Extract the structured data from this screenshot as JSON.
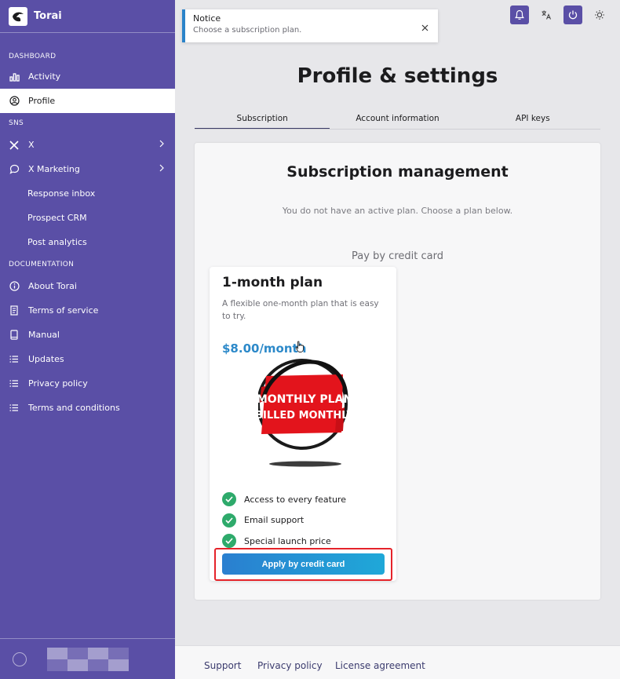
{
  "app": {
    "name": "Torai"
  },
  "sidebar": {
    "sections": [
      {
        "label": "DASHBOARD"
      },
      {
        "label": "SNS"
      },
      {
        "label": "DOCUMENTATION"
      }
    ],
    "items": [
      {
        "label": "Activity",
        "icon": "bar-chart-icon"
      },
      {
        "label": "Profile",
        "icon": "user-circle-icon",
        "active": true
      },
      {
        "label": "X",
        "icon": "x-logo-icon"
      },
      {
        "label": "X Marketing",
        "icon": "chat-bubble-icon"
      },
      {
        "label": "Response inbox"
      },
      {
        "label": "Prospect CRM"
      },
      {
        "label": "Post analytics"
      },
      {
        "label": "About Torai",
        "icon": "info-icon"
      },
      {
        "label": "Terms of service",
        "icon": "document-icon"
      },
      {
        "label": "Manual",
        "icon": "book-icon"
      },
      {
        "label": "Updates",
        "icon": "list-icon"
      },
      {
        "label": "Privacy policy",
        "icon": "list-icon"
      },
      {
        "label": "Terms and conditions",
        "icon": "list-icon"
      }
    ]
  },
  "toast": {
    "title": "Notice",
    "message": "Choose a subscription plan."
  },
  "page": {
    "title": "Profile & settings"
  },
  "tabs": [
    {
      "label": "Subscription",
      "active": true
    },
    {
      "label": "Account information"
    },
    {
      "label": "API keys"
    }
  ],
  "subscription": {
    "title": "Subscription management",
    "description": "You do not have an active plan. Choose a plan below.",
    "pay_label": "Pay by credit card",
    "plan": {
      "name": "1-month plan",
      "description": "A flexible one-month plan that is easy to try.",
      "price": "$8.00/month",
      "image_text_line1": "MONTHLY PLAN",
      "image_text_line2": "BILLED MONTHLY",
      "features": [
        "Access to every feature",
        "Email support",
        "Special launch price"
      ],
      "button_label": "Apply by credit card"
    }
  },
  "footer": {
    "links": [
      "Support",
      "Privacy policy",
      "License agreement"
    ]
  },
  "colors": {
    "sidebar": "#5a4fa6",
    "accent": "#2c89c9",
    "check": "#2eaa6b",
    "highlight": "#e5232a"
  }
}
